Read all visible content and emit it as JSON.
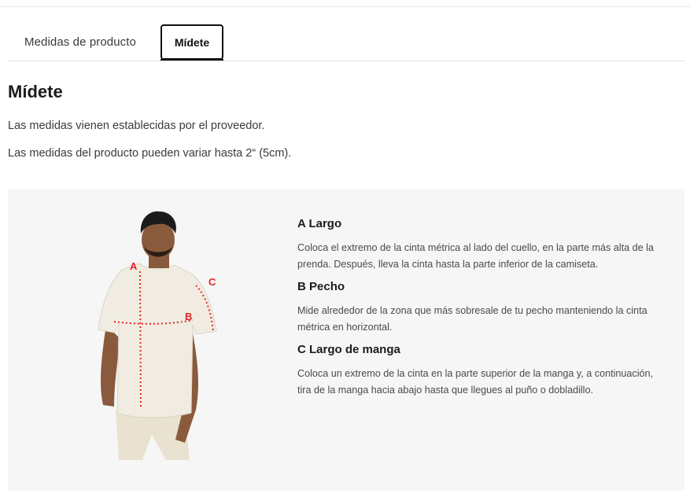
{
  "tabs": [
    {
      "label": "Medidas de producto",
      "active": false
    },
    {
      "label": "Mídete",
      "active": true
    }
  ],
  "section": {
    "title": "Mídete",
    "paragraphs": [
      "Las medidas vienen establecidas por el proveedor.",
      "Las medidas del producto pueden variar hasta 2“ (5cm)."
    ]
  },
  "figure": {
    "markers": [
      "A",
      "B",
      "C"
    ],
    "marker_color": "#e0242c",
    "shirt_color": "#f1ece1"
  },
  "measurements": [
    {
      "heading": "A Largo",
      "text": "Coloca el extremo de la cinta métrica al lado del cuello, en la parte más alta de la prenda. Después, lleva la cinta hasta la parte inferior de la camiseta."
    },
    {
      "heading": "B Pecho",
      "text": "Mide alrededor de la zona que más sobresale de tu pecho manteniendo la cinta métrica en horizontal."
    },
    {
      "heading": "C Largo de manga",
      "text": "Coloca un extremo de la cinta en la parte superior de la manga y, a continuación, tira de la manga hacia abajo hasta que llegues al puño o dobladillo."
    }
  ]
}
